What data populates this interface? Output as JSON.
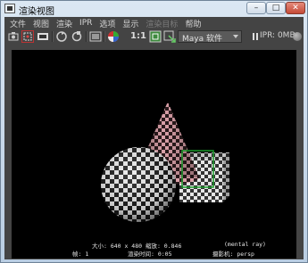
{
  "window": {
    "title": "渲染视图",
    "min_glyph": "–",
    "max_glyph": "□",
    "close_glyph": "✕"
  },
  "menu": [
    "文件",
    "视图",
    "渲染",
    "IPR",
    "选项",
    "显示",
    "渲染目标",
    "帮助"
  ],
  "menu_disabled": [
    false,
    false,
    false,
    false,
    false,
    false,
    true,
    false
  ],
  "toolbar": {
    "ratio_label": "1:1",
    "renderer": "Maya 软件",
    "ipr_status": "IPR: 0MB"
  },
  "status": {
    "size": "大小: 640 x 480  缩放: 0.846",
    "renderer_tag": "(mental ray)",
    "frame": "帧: 1",
    "render_time": "渲染时间: 0:05",
    "camera": "摄影机: persp"
  },
  "colors": {
    "menubar_bg": "#444444",
    "viewport_bg": "#000000",
    "highlight_red": "#c05060",
    "region_green": "#1a9a2a"
  }
}
